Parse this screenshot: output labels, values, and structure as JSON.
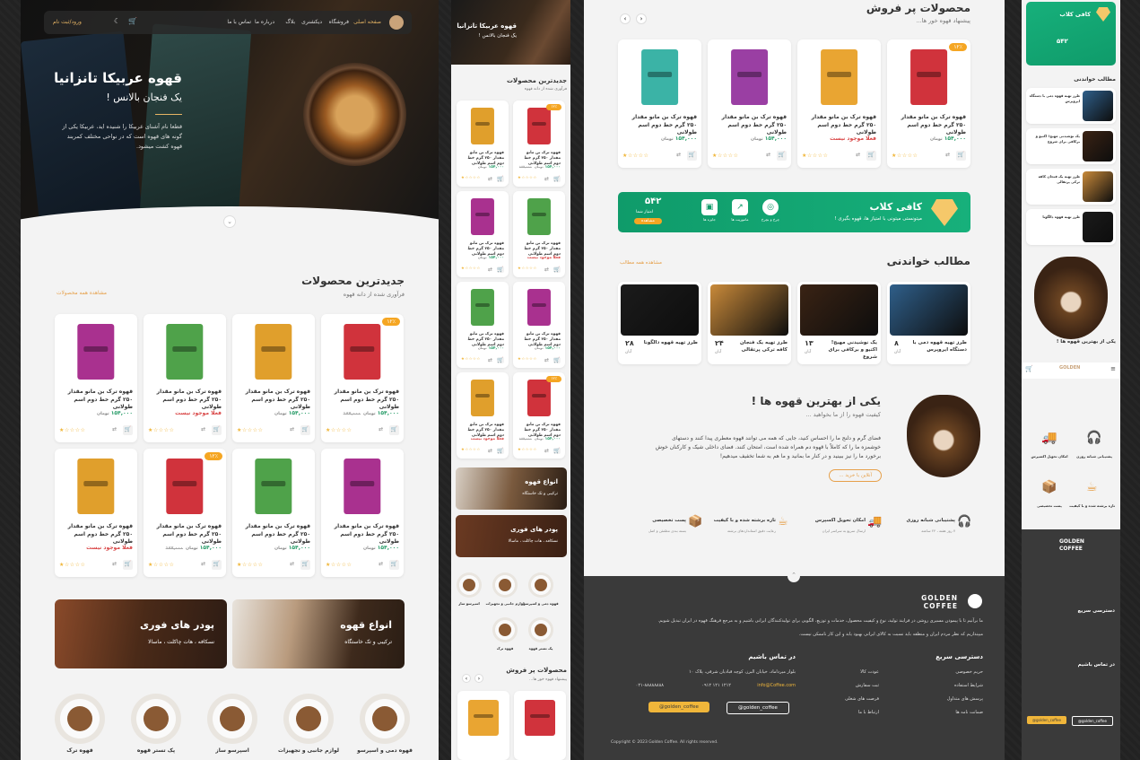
{
  "header": {
    "logo": "coffee-beans-logo",
    "menu": [
      "صفحه اصلی",
      "فروشگاه",
      "دیکشنری",
      "بلاگ",
      "درباره ما",
      "تماس با ما"
    ],
    "login_label": "ورود/ثبت نام"
  },
  "hero": {
    "title": "قهوه عربیکا تانزانیا",
    "subtitle": "یک فنجان بالانس !",
    "desc_line1": "قطعا نام آشنای عربیکا را شنیده اید، عربیکا یکی از",
    "desc_line2": "گونه های قهوه است که در نواحی مختلف کمربند",
    "desc_line3": "قهوه کشت میشود."
  },
  "latest": {
    "title": "جدیدترین محصولات",
    "subtitle": "فرآوری شده از دانه قهوه",
    "link": "مشاهده همه محصولات",
    "products": [
      {
        "name": "قهوه ترک بن مانو مقدار ۲۵۰ گرم خط دوم اسم طولانی",
        "price": "۱۵۴,۰۰۰",
        "old": "۱۸۷,۰۰۰",
        "unit": "تومان",
        "color": "#d0333c",
        "badge": "۱۲٪"
      },
      {
        "name": "قهوه ترک بن مانو مقدار ۲۵۰ گرم خط دوم اسم طولانی",
        "price": "۱۵۴,۰۰۰",
        "old": "",
        "unit": "تومان",
        "color": "#e09f2c",
        "badge": ""
      },
      {
        "name": "قهوه ترک بن مانو مقدار ۲۵۰ گرم خط دوم اسم طولانی",
        "price": "فعلا موجود نیست",
        "old": "",
        "unit": "",
        "color": "#4fa24a",
        "badge": ""
      },
      {
        "name": "قهوه ترک بن مانو مقدار ۲۵۰ گرم خط دوم اسم طولانی",
        "price": "۱۵۴,۰۰۰",
        "old": "",
        "unit": "تومان",
        "color": "#a9318f",
        "badge": ""
      },
      {
        "name": "قهوه ترک بن مانو مقدار ۲۵۰ گرم خط دوم اسم طولانی",
        "price": "۱۵۴,۰۰۰",
        "old": "",
        "unit": "تومان",
        "color": "#a9318f",
        "badge": ""
      },
      {
        "name": "قهوه ترک بن مانو مقدار ۲۵۰ گرم خط دوم اسم طولانی",
        "price": "۱۵۴,۰۰۰",
        "old": "",
        "unit": "تومان",
        "color": "#4fa24a",
        "badge": ""
      },
      {
        "name": "قهوه ترک بن مانو مقدار ۲۵۰ گرم خط دوم اسم طولانی",
        "price": "۱۵۴,۰۰۰",
        "old": "۱۸۷,۰۰۰",
        "unit": "تومان",
        "color": "#d0333c",
        "badge": "۱۲٪"
      },
      {
        "name": "قهوه ترک بن مانو مقدار ۲۵۰ گرم خط دوم اسم طولانی",
        "price": "فعلا موجود نیست",
        "old": "",
        "unit": "",
        "color": "#e09f2c",
        "badge": ""
      }
    ]
  },
  "categories_banner": [
    {
      "title": "انواع قهوه",
      "sub": "ترکیبی و تک خاستگاه"
    },
    {
      "title": "پودر های فوری",
      "sub": "نسکافه ، هات چاکلت ، ماسالا"
    }
  ],
  "cat_icons": [
    "قهوه دمی و اسپرسو",
    "لوازم جانبی و تجهیزات",
    "اسپرسو ساز",
    "پک تستر قهوه",
    "قهوه ترک"
  ],
  "bestsell": {
    "title": "محصولات پر فروش",
    "subtitle": "پیشنهاد قهوه خور ها...",
    "products": [
      {
        "name": "قهوه ترک بن مانو مقدار ۲۵۰ گرم خط دوم اسم طولانی",
        "price": "۱۵۴,۰۰۰",
        "unit": "تومان",
        "color": "#d0333c",
        "badge": "۱۲٪"
      },
      {
        "name": "قهوه ترک بن مانو مقدار ۲۵۰ گرم خط دوم اسم طولانی",
        "price": "فعلا موجود نیست",
        "unit": "",
        "color": "#e9a532",
        "badge": ""
      },
      {
        "name": "قهوه ترک بن مانو مقدار ۲۵۰ گرم خط دوم اسم طولانی",
        "price": "۱۵۴,۰۰۰",
        "unit": "تومان",
        "color": "#9a3fa3",
        "badge": ""
      },
      {
        "name": "قهوه ترک بن مانو مقدار ۲۵۰ گرم خط دوم اسم طولانی",
        "price": "۱۵۴,۰۰۰",
        "unit": "تومان",
        "color": "#3bb3a6",
        "badge": ""
      }
    ]
  },
  "club": {
    "title": "کافی کلاب",
    "desc": "میتونستی میتونی با امتیاز ها، قهوه بگیری !",
    "points": "۵۴۲",
    "points_label": "امتیاز شما",
    "points_btn": "مشاهده",
    "items": [
      "چرخ و بچرخ",
      "ماموریت ها",
      "جایزه ها"
    ]
  },
  "blog": {
    "title": "مطالب خواندنی",
    "link": "مشاهده همه مطالب",
    "posts": [
      {
        "title": "طرز تهیه قهوه دمی با دستگاه ایروپرس",
        "day": "۸",
        "month": "آبان"
      },
      {
        "title": "یک نوشیدنی مهیج! اکتیو و برکافی برای شروع",
        "day": "۱۳",
        "month": "آبان"
      },
      {
        "title": "طرز تهیه یک فنجان کافه ترکی پرتقالی",
        "day": "۲۴",
        "month": "آبان"
      },
      {
        "title": "طرز تهیه قهوه دالگونا",
        "day": "۲۸",
        "month": "آبان"
      }
    ]
  },
  "best_section": {
    "title": "یکی از بهترین قهوه ها !",
    "sub": "کیفیت قهوه را از ما بخواهید ...",
    "body1": "فضای گرم و دلنج ما را احساس کنید، جایی که همه می توانند قهوه معطری پیدا کنند و دستهای",
    "body2": "خوشمزه ما را که کاملاً با قهوه دم همراه شده است، امتحان کنند. فضای داخلی شیک و کارکنان خوش",
    "body3": "برخورد ما را نیز ببینید و در کنار ما بمانید و ما هم به شما تخفیف میدهیم!",
    "btn": "آنلاین با خرید ..."
  },
  "services": [
    {
      "t": "پشتیبانی شبانه روزی",
      "d": "۷ روز هفته ، ۲۴ ساعته"
    },
    {
      "t": "امکان تحویل اکسپرس",
      "d": "ارسال سریع به سراسر ایران"
    },
    {
      "t": "تازه برشته شده و با کیفیت",
      "d": "رعایت دقیق استانداردهای برشته"
    },
    {
      "t": "پست تخصیصی",
      "d": "بسته بندی مطمئن و اصل"
    }
  ],
  "footer": {
    "brand1": "GOLDEN",
    "brand2": "COFFEE",
    "about": "ما برآنیم تا با پیمودن مسیری روشن در فرایند تولید، نوع و کیفیت محصول، خدمات و توزیع، الگویی برای تولیدکنندگان ایرانی باشیم و به مرجع فرهنگ قهوه در ایران تبدیل شویم.",
    "about2": "میپنداریم که نظر مردم ایران و منطقه باید نسبت به کالای ایرانی بهبود یابد و این کار ناممکن نیست.",
    "quick_title": "دسترسی سریع",
    "quick": [
      "حریم خصوصی",
      "شرایط استفاده",
      "پرسش های متداول",
      "ضمانت نامه ها",
      "عودت کالا",
      "ثبت سفارش",
      "فرصت های شغلی",
      "ارتباط با ما"
    ],
    "contact_title": "در تماس باشیم",
    "address": "بلوار میرداماد، خیابان البرز، کوچه قبادیان شرقی، پلاک ۱۰",
    "phone": "۰۲۱-۸۸۸۸۸۸۸۸",
    "email": "info@Coffee.com",
    "phone2": "۰۹۱۲ ۱۲۱ ۱۲۱۲",
    "telegram": "@golden_coffee",
    "instagram": "@golden_coffee",
    "copyright": "Copyright © 2023 Golden Coffee. All rights reserved."
  }
}
